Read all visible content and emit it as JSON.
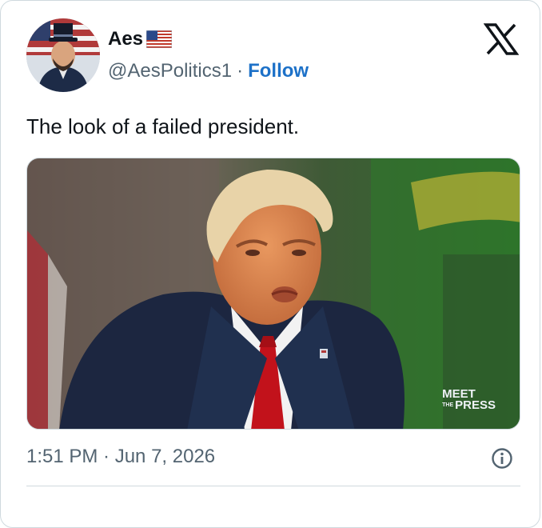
{
  "author": {
    "name": "Aes",
    "handle": "@AesPolitics1",
    "follow_label": "Follow",
    "separator": "·",
    "flag": "us-flag-icon"
  },
  "tweet": {
    "text": "The look of a failed president.",
    "timestamp": "1:51 PM · Jun 7, 2026"
  },
  "media": {
    "watermark_line1": "MEET",
    "watermark_line2": "PRESS",
    "watermark_small": "THE"
  },
  "icons": {
    "platform": "x-logo-icon",
    "info": "info-icon"
  },
  "colors": {
    "follow": "#1d71c8",
    "text": "#0f1419",
    "secondary": "#536471",
    "border": "#cfd9de"
  }
}
